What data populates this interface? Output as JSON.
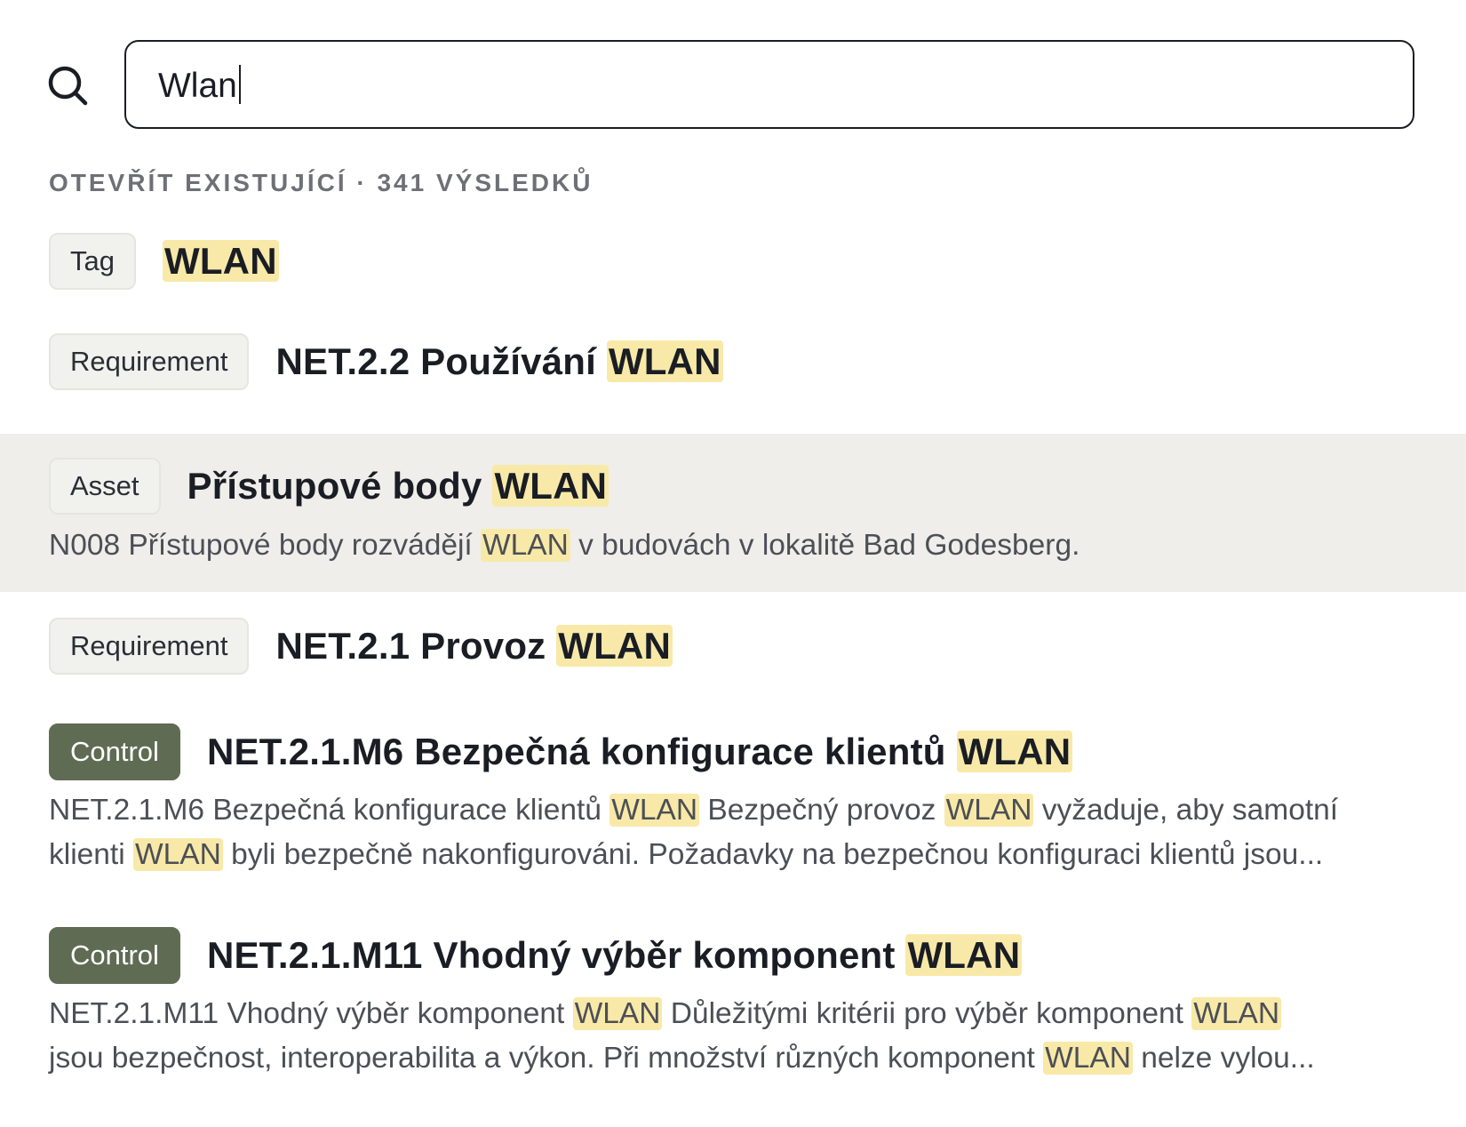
{
  "search": {
    "value": "Wlan"
  },
  "section_header": "OTEVŘÍT EXISTUJÍCÍ · 341 VÝSLEDKŮ",
  "highlight_color": "#f8e9a8",
  "selected_row_color": "#efeeea",
  "control_badge_color": "#5f6b53",
  "results": [
    {
      "type": "Tag",
      "title_pre": "",
      "title_hl": "WLAN"
    },
    {
      "type": "Requirement",
      "title_pre": "NET.2.2 Používání ",
      "title_hl": "WLAN"
    },
    {
      "type": "Asset",
      "title_pre": "Přístupové body ",
      "title_hl": "WLAN",
      "snippet": {
        "t1": "N008 Přístupové body rozvádějí ",
        "h1": "WLAN",
        "t2": " v budovách v lokalitě Bad Godesberg."
      }
    },
    {
      "type": "Requirement",
      "title_pre": "NET.2.1 Provoz ",
      "title_hl": "WLAN"
    },
    {
      "type": "Control",
      "title_pre": "NET.2.1.M6 Bezpečná konfigurace klientů ",
      "title_hl": "WLAN",
      "snippet": {
        "l1_t1": "NET.2.1.M6 Bezpečná konfigurace klientů ",
        "l1_h1": "WLAN",
        "l1_t2": " Bezpečný provoz ",
        "l1_h2": "WLAN",
        "l1_t3": " vyžaduje, aby samotní",
        "l2_t1": "klienti ",
        "l2_h1": "WLAN",
        "l2_t2": " byli bezpečně nakonfigurováni. Požadavky na bezpečnou konfiguraci klientů jsou..."
      }
    },
    {
      "type": "Control",
      "title_pre": "NET.2.1.M11 Vhodný výběr komponent ",
      "title_hl": "WLAN",
      "snippet": {
        "l1_t1": "NET.2.1.M11 Vhodný výběr komponent ",
        "l1_h1": "WLAN",
        "l1_t2": " Důležitými kritérii pro výběr komponent ",
        "l1_h2": "WLAN",
        "l2_t1": "jsou bezpečnost, interoperabilita a výkon. Při množství různých komponent ",
        "l2_h1": "WLAN",
        "l2_t2": " nelze vylou..."
      }
    }
  ]
}
